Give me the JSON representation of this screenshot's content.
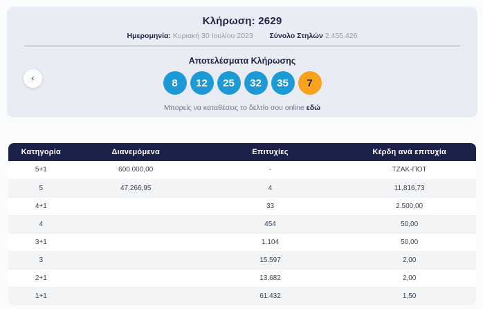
{
  "draw_card": {
    "title_label": "Κλήρωση:",
    "title_number": "2629",
    "date_label": "Ημερομηνία:",
    "date_value": "Κυριακή 30 Ιουλίου 2023",
    "columns_label": "Σύνολο Στηλών",
    "columns_value": "2.455.426",
    "results_heading": "Αποτελέσματα Κλήρωσης",
    "numbers": [
      "8",
      "12",
      "25",
      "32",
      "35"
    ],
    "bonus_number": "7",
    "caption_text": "Μπορείς να καταθέσεις το δελτίο σου online",
    "caption_link": "εδώ",
    "prev_icon": "‹"
  },
  "colors": {
    "ball_blue": "#1d9ad6",
    "ball_bonus_orange": "#f8a21c",
    "header_navy": "#1b2149",
    "card_background": "#e9edf3"
  },
  "table": {
    "headers": [
      "Κατηγορία",
      "Διανεμόμενα",
      "Επιτυχίες",
      "Κέρδη ανά επιτυχία"
    ],
    "rows": [
      [
        "5+1",
        "600.000,00",
        "-",
        "ΤΖΑΚ-ΠΟΤ"
      ],
      [
        "5",
        "47.266,95",
        "4",
        "11.816,73"
      ],
      [
        "4+1",
        "",
        "33",
        "2.500,00"
      ],
      [
        "4",
        "",
        "454",
        "50,00"
      ],
      [
        "3+1",
        "",
        "1.104",
        "50,00"
      ],
      [
        "3",
        "",
        "15.597",
        "2,00"
      ],
      [
        "2+1",
        "",
        "13.682",
        "2,00"
      ],
      [
        "1+1",
        "",
        "61.432",
        "1,50"
      ]
    ]
  }
}
